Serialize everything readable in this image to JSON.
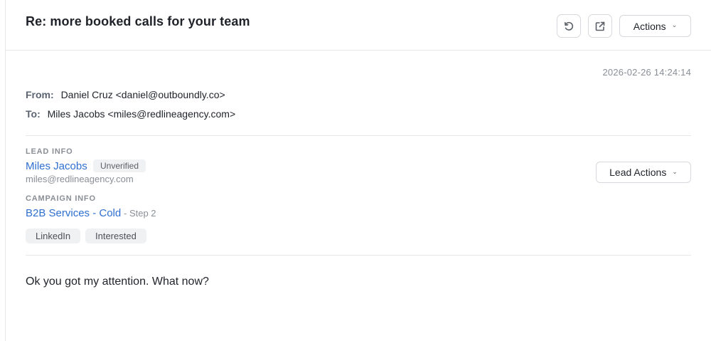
{
  "header": {
    "subject": "Re: more booked calls for your team",
    "actions_label": "Actions",
    "icons": [
      "undo-icon",
      "external-link-icon",
      "chevron-down-icon"
    ]
  },
  "message": {
    "timestamp": "2026-02-26 14:24:14",
    "from_label": "From:",
    "from_value": "Daniel Cruz <daniel@outboundly.co>",
    "to_label": "To:",
    "to_value": "Miles Jacobs <miles@redlineagency.com>",
    "body": "Ok you got my attention. What now?"
  },
  "lead": {
    "section_label": "LEAD INFO",
    "name": "Miles Jacobs",
    "status_badge": "Unverified",
    "email": "miles@redlineagency.com",
    "actions_label": "Lead Actions"
  },
  "campaign": {
    "section_label": "CAMPAIGN INFO",
    "name": "B2B Services - Cold",
    "step": "- Step 2"
  },
  "tags": [
    "LinkedIn",
    "Interested"
  ],
  "colors": {
    "link": "#2f6fcf",
    "muted": "#8a8f96",
    "border": "#d5d8dc",
    "badge_bg": "#f0f1f3"
  }
}
